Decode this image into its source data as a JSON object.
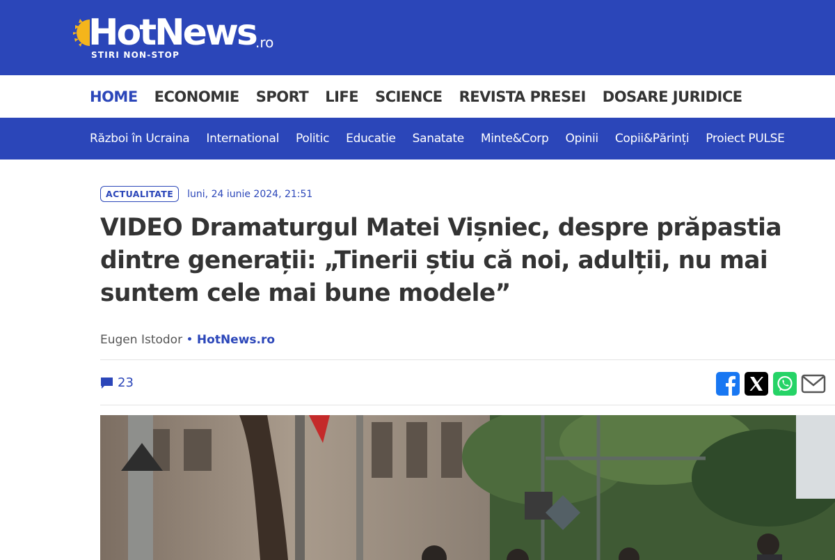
{
  "header": {
    "brand": "HotNews",
    "tld": ".ro",
    "tagline": "STIRI NON-STOP"
  },
  "main_nav": [
    {
      "label": "HOME"
    },
    {
      "label": "ECONOMIE"
    },
    {
      "label": "SPORT"
    },
    {
      "label": "LIFE"
    },
    {
      "label": "SCIENCE"
    },
    {
      "label": "REVISTA PRESEI"
    },
    {
      "label": "DOSARE JURIDICE"
    }
  ],
  "sub_nav": [
    {
      "label": "Război în Ucraina"
    },
    {
      "label": "International"
    },
    {
      "label": "Politic"
    },
    {
      "label": "Educatie"
    },
    {
      "label": "Sanatate"
    },
    {
      "label": "Minte&Corp"
    },
    {
      "label": "Opinii"
    },
    {
      "label": "Copii&Părinți"
    },
    {
      "label": "Proiect PULSE"
    }
  ],
  "article": {
    "category": "ACTUALITATE",
    "date": "luni, 24 iunie 2024, 21:51",
    "title": "VIDEO Dramaturgul Matei Vișniec, despre prăpastia dintre generații: „Tinerii știu că noi, adulții, nu mai suntem cele mai bune modele”",
    "author": "Eugen Istodor",
    "separator": "•",
    "source": "HotNews.ro",
    "comment_count": "23"
  },
  "share": [
    {
      "icon": "facebook-icon",
      "color": "#1877f2"
    },
    {
      "icon": "x-icon",
      "color": "#000000"
    },
    {
      "icon": "whatsapp-icon",
      "color": "#25d366"
    },
    {
      "icon": "email-icon",
      "color": "#555555"
    }
  ],
  "colors": {
    "brand_blue": "#2b46b9",
    "sun_yellow": "#f5b51b",
    "text_dark": "#333333"
  }
}
